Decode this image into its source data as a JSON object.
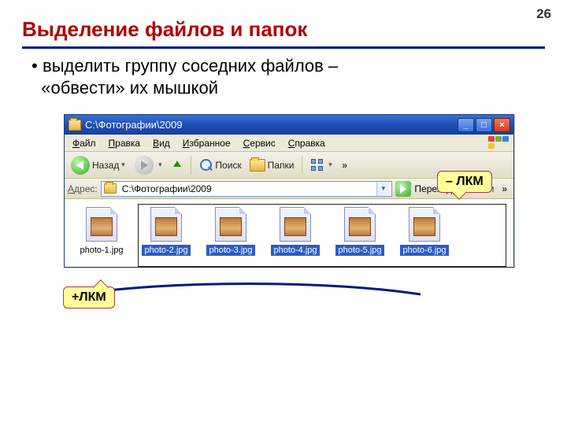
{
  "page_number": "26",
  "title": "Выделение файлов и папок",
  "body_line1": "выделить группу соседних файлов –",
  "body_line2": "«обвести» их мышкой",
  "window": {
    "title": "C:\\Фотографии\\2009",
    "menu": {
      "file": {
        "u": "Ф",
        "rest": "айл"
      },
      "edit": {
        "u": "П",
        "rest": "равка"
      },
      "view": {
        "u": "В",
        "rest": "ид"
      },
      "fav": {
        "u": "И",
        "rest": "збранное"
      },
      "tools": {
        "u": "С",
        "rest": "ервис"
      },
      "help": {
        "u": "С",
        "rest": "правка"
      }
    },
    "toolbar": {
      "back": "Назад",
      "search": "Поиск",
      "folders": "Папки",
      "more": "»"
    },
    "address": {
      "label": "Адрес:",
      "path": "C:\\Фотографии\\2009",
      "go": "Переход",
      "links": "Ссылки",
      "more": "»"
    },
    "files": [
      {
        "name": "photo-1.jpg",
        "selected": false
      },
      {
        "name": "photo-2.jpg",
        "selected": true
      },
      {
        "name": "photo-3.jpg",
        "selected": true
      },
      {
        "name": "photo-4.jpg",
        "selected": true
      },
      {
        "name": "photo-5.jpg",
        "selected": true
      },
      {
        "name": "photo-6.jpg",
        "selected": true
      }
    ]
  },
  "callouts": {
    "start": "+ЛКМ",
    "end": "– ЛКМ"
  }
}
